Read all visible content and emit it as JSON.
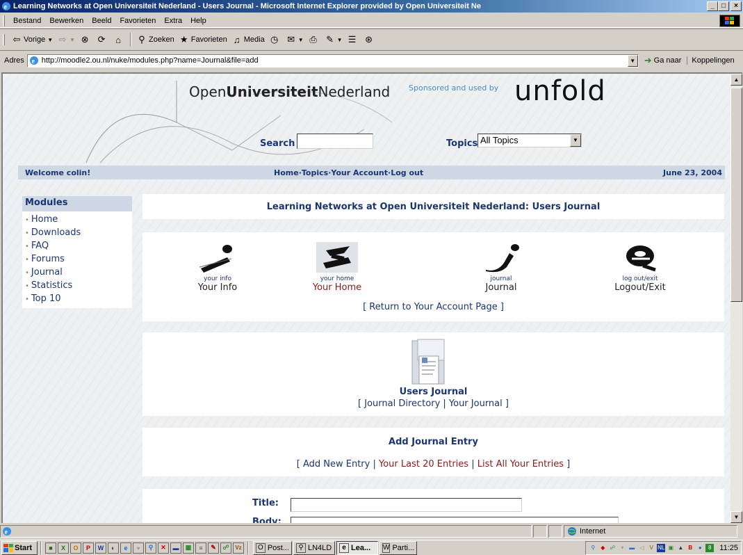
{
  "window": {
    "title": "Learning Networks at Open Universiteit Nederland - Users Journal - Microsoft Internet Explorer provided by Open Universiteit Ne",
    "minimize": "_",
    "maximize": "□",
    "close": "×"
  },
  "menu": [
    "Bestand",
    "Bewerken",
    "Beeld",
    "Favorieten",
    "Extra",
    "Help"
  ],
  "toolbar": {
    "back": "Vorige",
    "search": "Zoeken",
    "favorites": "Favorieten",
    "media": "Media"
  },
  "address": {
    "label": "Adres",
    "url": "http://moodle2.ou.nl/nuke/modules.php?name=Journal&file=add",
    "go": "Ga naar",
    "links": "Koppelingen"
  },
  "page": {
    "logo_prefix": "Open",
    "logo_bold": "Universiteit",
    "logo_suffix": "Nederland",
    "sponsor": "Sponsored and used by",
    "unfold": "unfold",
    "search_label": "Search",
    "search_value": "",
    "topics_label": "Topics",
    "topics_selected": "All Topics",
    "welcome": "Welcome colin!",
    "nav": [
      "Home",
      "Topics",
      "Your Account",
      "Log out"
    ],
    "nav_sep": " · ",
    "date": "June 23, 2004",
    "modules_title": "Modules",
    "modules": [
      "Home",
      "Downloads",
      "FAQ",
      "Forums",
      "Journal",
      "Statistics",
      "Top 10"
    ],
    "heading": "Learning Networks at Open Universiteit Nederland: Users Journal",
    "icons": [
      {
        "small": "your info",
        "big": "Your Info"
      },
      {
        "small": "your home",
        "big": "Your Home"
      },
      {
        "small": "journal",
        "big": "Journal"
      },
      {
        "small": "log out/exit",
        "big": "Logout/Exit"
      }
    ],
    "return_link": "[ Return to Your Account Page ]",
    "users_journal": "Users Journal",
    "journal_links": "[ Journal Directory | Your Journal ]",
    "add_title": "Add Journal Entry",
    "add_link_new": "[ Add New Entry | ",
    "add_link_last": "Your Last 20 Entries",
    "add_link_sep": " | ",
    "add_link_all": "List All Your Entries",
    "add_link_end": " ]",
    "title_label": "Title:",
    "body_label": "Body:"
  },
  "status": {
    "zone": "Internet"
  },
  "taskbar": {
    "start": "Start",
    "tasks": [
      "Post...",
      "LN4LD",
      "Lea...",
      "Parti..."
    ],
    "clock": "11:25"
  }
}
